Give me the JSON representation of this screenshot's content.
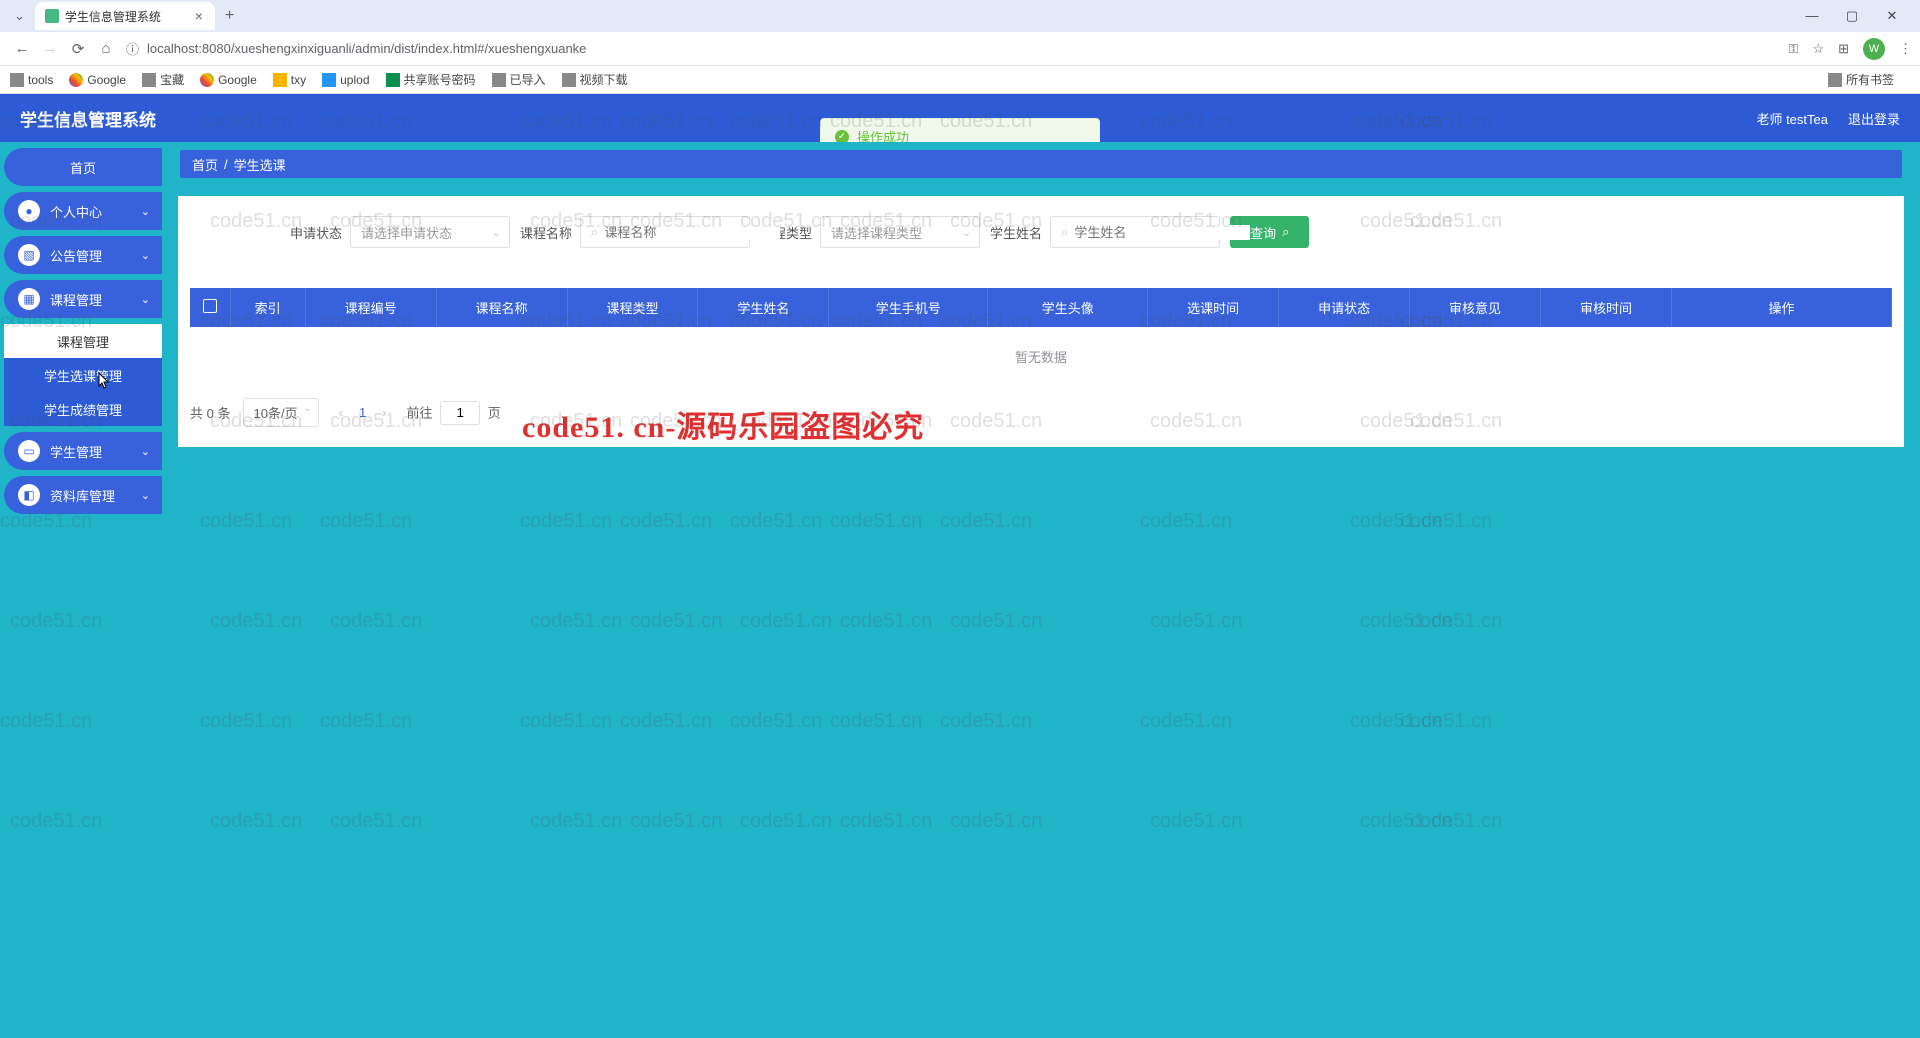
{
  "browser": {
    "tab_title": "学生信息管理系统",
    "url": "localhost:8080/xueshengxinxiguanli/admin/dist/index.html#/xueshengxuanke",
    "bookmarks": [
      "tools",
      "Google",
      "宝藏",
      "Google",
      "txy",
      "uplod",
      "共享账号密码",
      "已导入",
      "视频下载"
    ],
    "bookmark_right": "所有书签",
    "avatar_letter": "W"
  },
  "header": {
    "app_title": "学生信息管理系统",
    "user_label": "老师 testTea",
    "logout": "退出登录"
  },
  "toast": "操作成功",
  "sidebar": {
    "home": "首页",
    "items": [
      {
        "label": "个人中心"
      },
      {
        "label": "公告管理"
      },
      {
        "label": "课程管理"
      }
    ],
    "subs": [
      "课程管理",
      "学生选课管理",
      "学生成绩管理"
    ],
    "items2": [
      {
        "label": "学生管理"
      },
      {
        "label": "资料库管理"
      }
    ]
  },
  "breadcrumb": {
    "home": "首页",
    "current": "学生选课"
  },
  "filters": {
    "status_label": "申请状态",
    "status_placeholder": "请选择申请状态",
    "course_name_label": "课程名称",
    "course_name_placeholder": "课程名称",
    "course_type_label": "课程类型",
    "course_type_placeholder": "请选择课程类型",
    "student_name_label": "学生姓名",
    "student_name_placeholder": "学生姓名",
    "search_btn": "查询"
  },
  "table": {
    "headers": [
      "索引",
      "课程编号",
      "课程名称",
      "课程类型",
      "学生姓名",
      "学生手机号",
      "学生头像",
      "选课时间",
      "申请状态",
      "审核意见",
      "审核时间",
      "操作"
    ],
    "nodata": "暂无数据"
  },
  "pagination": {
    "total_prefix": "共",
    "total_count": "0",
    "total_suffix": "条",
    "perpage": "10条/页",
    "current": "1",
    "goto_prefix": "前往",
    "goto_value": "1",
    "goto_suffix": "页"
  },
  "watermark_text": "code51.cn",
  "watermark_red": "code51. cn-源码乐园盗图必究"
}
